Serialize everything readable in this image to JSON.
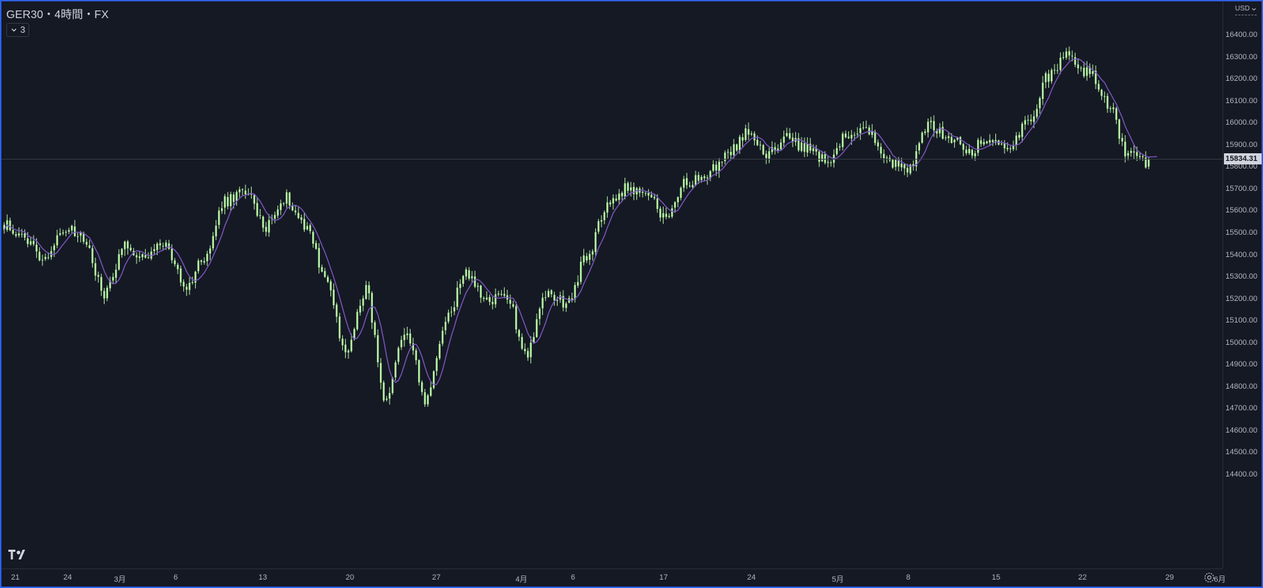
{
  "header": {
    "symbol_title": "GER30・4時間・FX",
    "indicator_count": "3",
    "currency": "USD"
  },
  "price_scale": {
    "labels": [
      "16400.00",
      "16300.00",
      "16200.00",
      "16100.00",
      "16000.00",
      "15900.00",
      "15800.00",
      "15700.00",
      "15600.00",
      "15500.00",
      "15400.00",
      "15300.00",
      "15200.00",
      "15100.00",
      "15000.00",
      "14900.00",
      "14800.00",
      "14700.00",
      "14600.00",
      "14500.00",
      "14400.00"
    ],
    "last_price": "15834.31"
  },
  "time_scale": {
    "labels": [
      "21",
      "24",
      "3月",
      "6",
      "13",
      "20",
      "27",
      "4月",
      "6",
      "17",
      "24",
      "5月",
      "8",
      "15",
      "22",
      "29",
      "6月"
    ]
  },
  "chart_data": {
    "type": "candlestick",
    "title": "GER30・4時間・FX",
    "ylim": [
      14350,
      16450
    ],
    "last_price": 15834.31,
    "colors": {
      "candle": "#b9f6a5",
      "moving_average": "#7e57c2",
      "background": "#151924",
      "last_price_line": "#363a45"
    },
    "series": [
      {
        "type": "candlestick",
        "anchors": [
          {
            "x": "21",
            "close": 15540
          },
          {
            "x": "",
            "close": 15470
          },
          {
            "x": "",
            "close": 15390
          },
          {
            "x": "",
            "close": 15520
          },
          {
            "x": "24",
            "close": 15470
          },
          {
            "x": "",
            "close": 15220
          },
          {
            "x": "",
            "close": 15450
          },
          {
            "x": "3月",
            "close": 15380
          },
          {
            "x": "",
            "close": 15450
          },
          {
            "x": "",
            "close": 15250
          },
          {
            "x": "",
            "close": 15390
          },
          {
            "x": "6",
            "close": 15640
          },
          {
            "x": "",
            "close": 15690
          },
          {
            "x": "",
            "close": 15530
          },
          {
            "x": "",
            "close": 15660
          },
          {
            "x": "",
            "close": 15540
          },
          {
            "x": "",
            "close": 15300
          },
          {
            "x": "13",
            "close": 14950
          },
          {
            "x": "",
            "close": 15240
          },
          {
            "x": "",
            "close": 14720
          },
          {
            "x": "",
            "close": 15060
          },
          {
            "x": "",
            "close": 14740
          },
          {
            "x": "20",
            "close": 15100
          },
          {
            "x": "",
            "close": 15320
          },
          {
            "x": "",
            "close": 15180
          },
          {
            "x": "",
            "close": 15220
          },
          {
            "x": "27",
            "close": 14950
          },
          {
            "x": "",
            "close": 15220
          },
          {
            "x": "",
            "close": 15180
          },
          {
            "x": "",
            "close": 15380
          },
          {
            "x": "",
            "close": 15620
          },
          {
            "x": "4月",
            "close": 15700
          },
          {
            "x": "",
            "close": 15670
          },
          {
            "x": "6",
            "close": 15560
          },
          {
            "x": "",
            "close": 15730
          },
          {
            "x": "",
            "close": 15770
          },
          {
            "x": "17",
            "close": 15850
          },
          {
            "x": "",
            "close": 15950
          },
          {
            "x": "",
            "close": 15850
          },
          {
            "x": "",
            "close": 15930
          },
          {
            "x": "24",
            "close": 15880
          },
          {
            "x": "",
            "close": 15830
          },
          {
            "x": "",
            "close": 15940
          },
          {
            "x": "5月",
            "close": 15960
          },
          {
            "x": "",
            "close": 15820
          },
          {
            "x": "",
            "close": 15790
          },
          {
            "x": "8",
            "close": 15990
          },
          {
            "x": "",
            "close": 15940
          },
          {
            "x": "",
            "close": 15870
          },
          {
            "x": "15",
            "close": 15920
          },
          {
            "x": "",
            "close": 15900
          },
          {
            "x": "",
            "close": 15990
          },
          {
            "x": "",
            "close": 16210
          },
          {
            "x": "22",
            "close": 16300
          },
          {
            "x": "",
            "close": 16230
          },
          {
            "x": "",
            "close": 16080
          },
          {
            "x": "",
            "close": 15850
          },
          {
            "x": "",
            "close": 15820
          }
        ]
      },
      {
        "type": "line",
        "name": "",
        "note_visible": "moving average overlay"
      }
    ]
  }
}
